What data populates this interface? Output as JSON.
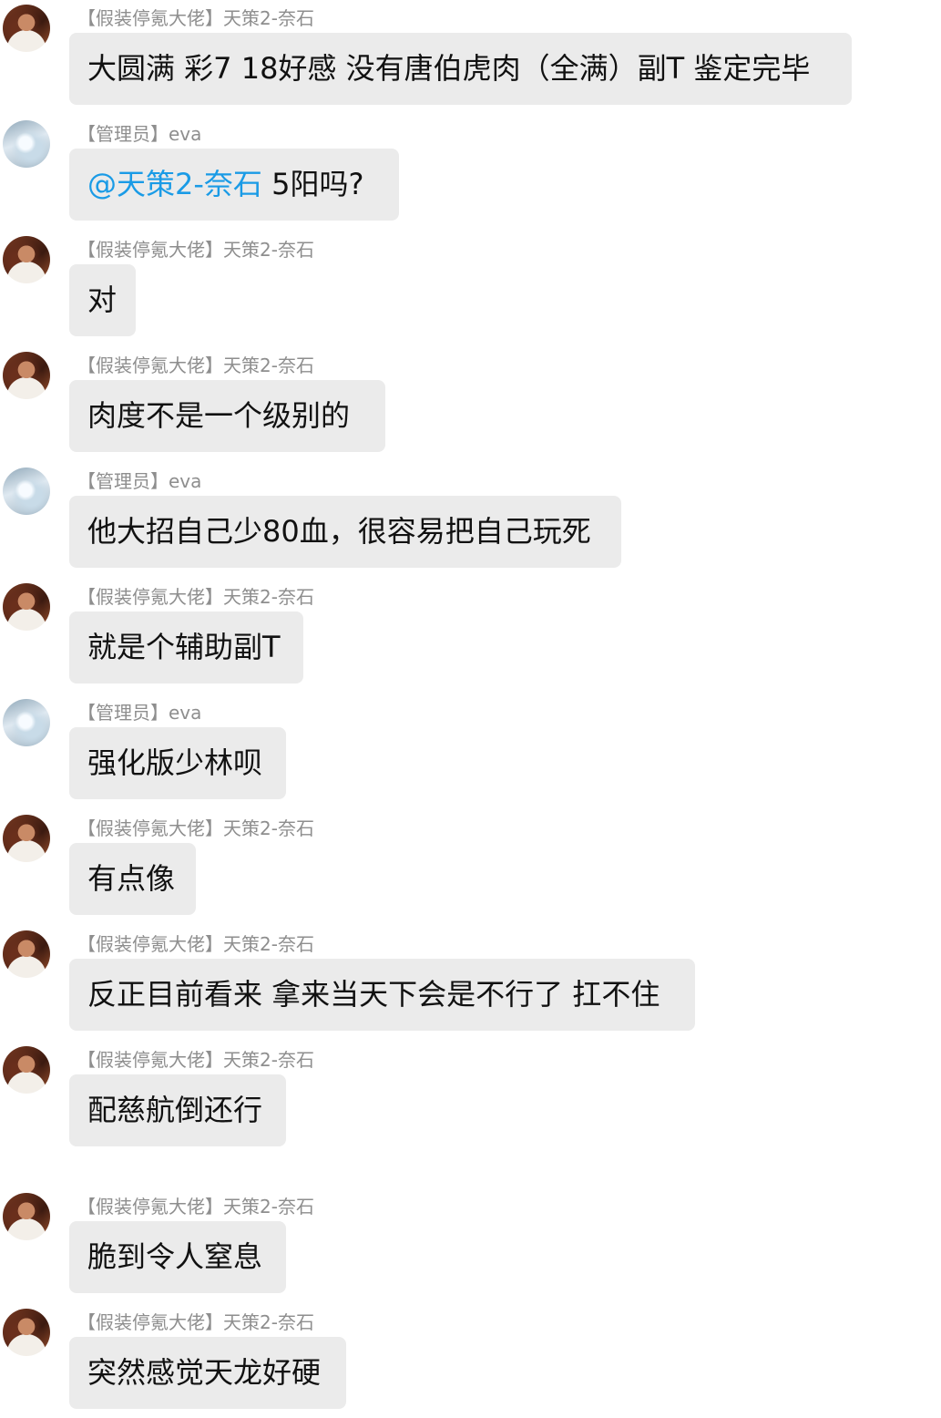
{
  "messages": [
    {
      "avatar": "a",
      "sender": "【假装停氪大佬】天策2-奈石",
      "text": "大圆满 彩7 18好感 没有唐伯虎肉（全满）副T 鉴定完毕"
    },
    {
      "avatar": "e",
      "sender": "【管理员】eva",
      "mention": "@天策2-奈石",
      "text": " 5阳吗?"
    },
    {
      "avatar": "a",
      "sender": "【假装停氪大佬】天策2-奈石",
      "text": "对"
    },
    {
      "avatar": "a",
      "sender": "【假装停氪大佬】天策2-奈石",
      "text": "肉度不是一个级别的"
    },
    {
      "avatar": "e",
      "sender": "【管理员】eva",
      "text": "他大招自己少80血，很容易把自己玩死"
    },
    {
      "avatar": "a",
      "sender": "【假装停氪大佬】天策2-奈石",
      "text": "就是个辅助副T"
    },
    {
      "avatar": "e",
      "sender": "【管理员】eva",
      "text": "强化版少林呗"
    },
    {
      "avatar": "a",
      "sender": "【假装停氪大佬】天策2-奈石",
      "text": "有点像"
    },
    {
      "avatar": "a",
      "sender": "【假装停氪大佬】天策2-奈石",
      "text": "反正目前看来 拿来当天下会是不行了 扛不住"
    },
    {
      "avatar": "a",
      "sender": "【假装停氪大佬】天策2-奈石",
      "text": "配慈航倒还行"
    },
    {
      "avatar": "a",
      "sender": "【假装停氪大佬】天策2-奈石",
      "text": "脆到令人窒息"
    },
    {
      "avatar": "a",
      "sender": "【假装停氪大佬】天策2-奈石",
      "text": "突然感觉天龙好硬"
    }
  ]
}
